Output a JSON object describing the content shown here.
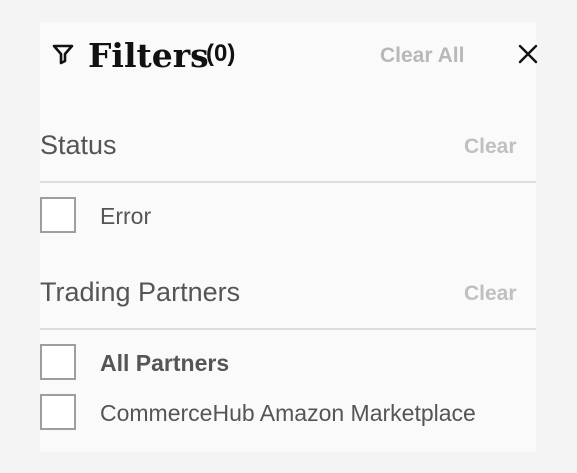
{
  "header": {
    "title": "Filters",
    "count": "(0)",
    "clear_all_label": "Clear All",
    "filter_icon": "filter-icon",
    "close_icon": "close-icon"
  },
  "sections": [
    {
      "title": "Status",
      "clear_label": "Clear",
      "options": [
        {
          "label": "Error",
          "checked": false
        }
      ]
    },
    {
      "title": "Trading Partners",
      "clear_label": "Clear",
      "options": [
        {
          "label": "All Partners",
          "checked": false
        },
        {
          "label": "CommerceHub Amazon Marketplace",
          "checked": false
        }
      ]
    }
  ],
  "colors": {
    "background": "#f5f4f4",
    "panel": "#fafafa",
    "title_text": "#111111",
    "muted_text": "#555555",
    "clear_text": "#b8b8b8",
    "checkbox_border": "#9e9e9e",
    "divider": "#dcdcdc"
  }
}
